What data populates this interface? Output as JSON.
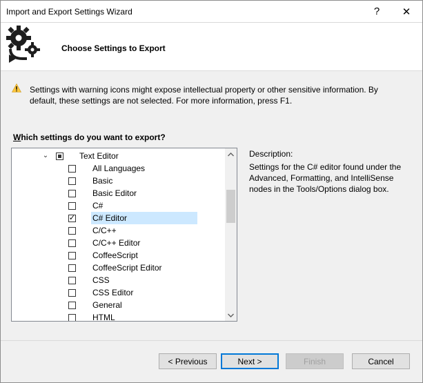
{
  "window": {
    "title": "Import and Export Settings Wizard",
    "help_glyph": "?",
    "close_glyph": "✕"
  },
  "banner": {
    "icon": "gears-export-icon",
    "title": "Choose Settings to Export"
  },
  "warning": {
    "icon": "warning-icon",
    "text": "Settings with warning icons might expose intellectual property or other sensitive information. By default, these settings are not selected. For more information, press F1."
  },
  "question": {
    "mnemonic": "W",
    "rest": "hich settings do you want to export?"
  },
  "tree": {
    "parent": {
      "label": "Text Editor",
      "expander": "⌄",
      "state": "partial"
    },
    "items": [
      {
        "label": "All Languages",
        "checked": false
      },
      {
        "label": "Basic",
        "checked": false
      },
      {
        "label": "Basic Editor",
        "checked": false
      },
      {
        "label": "C#",
        "checked": false
      },
      {
        "label": "C# Editor",
        "checked": true,
        "selected": true,
        "check_glyph": "✓"
      },
      {
        "label": "C/C++",
        "checked": false
      },
      {
        "label": "C/C++ Editor",
        "checked": false
      },
      {
        "label": "CoffeeScript",
        "checked": false
      },
      {
        "label": "CoffeeScript Editor",
        "checked": false
      },
      {
        "label": "CSS",
        "checked": false
      },
      {
        "label": "CSS Editor",
        "checked": false
      },
      {
        "label": "General",
        "checked": false
      },
      {
        "label": "HTML",
        "checked": false
      }
    ]
  },
  "description": {
    "label": "Description:",
    "text": "Settings for the C# editor found under the Advanced, Formatting, and IntelliSense nodes in the Tools/Options dialog box."
  },
  "buttons": {
    "previous": "< Previous",
    "next": "Next >",
    "finish": "Finish",
    "cancel": "Cancel"
  },
  "colors": {
    "selection": "#cce8ff",
    "default_button_border": "#0078d7",
    "dialog_background": "#f0f0f0",
    "warning_yellow": "#ffc83d"
  }
}
